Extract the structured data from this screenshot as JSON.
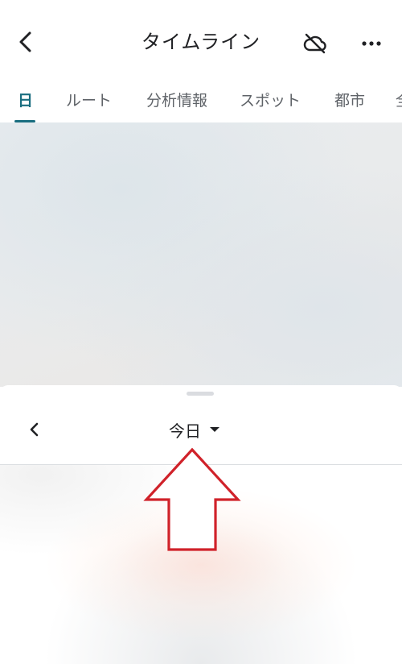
{
  "header": {
    "title": "タイムライン",
    "back_icon": "chevron-left-icon",
    "cloud_icon": "cloud-off-icon",
    "more_icon": "more-horizontal-icon"
  },
  "tabs": [
    {
      "label": "日",
      "active": true
    },
    {
      "label": "ルート",
      "active": false
    },
    {
      "label": "分析情報",
      "active": false
    },
    {
      "label": "スポット",
      "active": false
    },
    {
      "label": "都市",
      "active": false
    },
    {
      "label": "全",
      "active": false
    }
  ],
  "sheet": {
    "day_label": "今日",
    "prev_icon": "chevron-left-icon",
    "dropdown_icon": "caret-down-icon"
  },
  "colors": {
    "accent": "#1a6e80",
    "annotation": "#d0222a"
  }
}
